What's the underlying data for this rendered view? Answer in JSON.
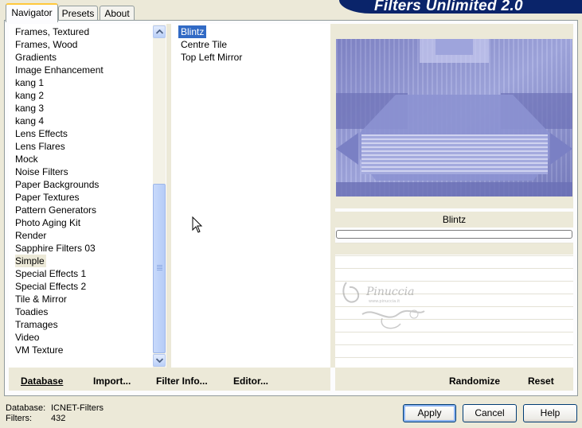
{
  "app": {
    "title": "Filters Unlimited 2.0",
    "tabs": [
      {
        "label": "Navigator",
        "active": true
      },
      {
        "label": "Presets",
        "active": false
      },
      {
        "label": "About",
        "active": false
      }
    ]
  },
  "categories": {
    "items": [
      "Frames, Textured",
      "Frames, Wood",
      "Gradients",
      "Image Enhancement",
      "kang 1",
      "kang 2",
      "kang 3",
      "kang 4",
      "Lens Effects",
      "Lens Flares",
      "Mock",
      "Noise Filters",
      "Paper Backgrounds",
      "Paper Textures",
      "Pattern Generators",
      "Photo Aging Kit",
      "Render",
      "Sapphire Filters 03",
      "Simple",
      "Special Effects 1",
      "Special Effects 2",
      "Tile & Mirror",
      "Toadies",
      "Tramages",
      "Video",
      "VM Texture"
    ],
    "selected": "Simple"
  },
  "filters": {
    "items": [
      "Blintz",
      "Centre Tile",
      "Top Left Mirror"
    ],
    "selected": "Blintz"
  },
  "preview": {
    "filter_name": "Blintz",
    "watermark_text": "Pinuccia",
    "watermark_sub": "www.pinuccia.it"
  },
  "buttons": {
    "database": "Database",
    "import": "Import...",
    "filter_info": "Filter Info...",
    "editor": "Editor...",
    "randomize": "Randomize",
    "reset": "Reset",
    "apply": "Apply",
    "cancel": "Cancel",
    "help": "Help"
  },
  "footer": {
    "database_label": "Database:",
    "database_value": "ICNET-Filters",
    "filters_label": "Filters:",
    "filters_value": "432"
  },
  "colors": {
    "selection": "#316AC5",
    "banner": "#0A246A",
    "face": "#ECE9D8",
    "preview_base": "#8E94CF"
  },
  "scrollbar": {
    "up_icon": "arrow-up-icon",
    "down_icon": "arrow-down-icon"
  }
}
